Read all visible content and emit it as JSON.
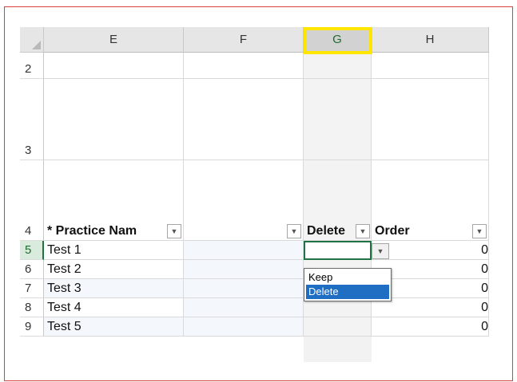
{
  "columns": [
    "E",
    "F",
    "G",
    "H"
  ],
  "selected_column": "G",
  "rows": [
    "2",
    "3",
    "4",
    "5",
    "6",
    "7",
    "8",
    "9"
  ],
  "header_row": {
    "e": "* Practice Nam",
    "g": "Delete",
    "h": "Order"
  },
  "data_rows": [
    {
      "name": "Test 1",
      "order": "0"
    },
    {
      "name": "Test 2",
      "order": "0"
    },
    {
      "name": "Test 3",
      "order": "0"
    },
    {
      "name": "Test 4",
      "order": "0"
    },
    {
      "name": "Test 5",
      "order": "0"
    }
  ],
  "dropdown": {
    "options": [
      "Keep",
      "Delete"
    ],
    "highlighted": "Delete"
  },
  "colors": {
    "frame": "#d94141",
    "highlight": "#ffe600",
    "selection": "#217346",
    "dropdown_highlight": "#1f6ec4"
  }
}
